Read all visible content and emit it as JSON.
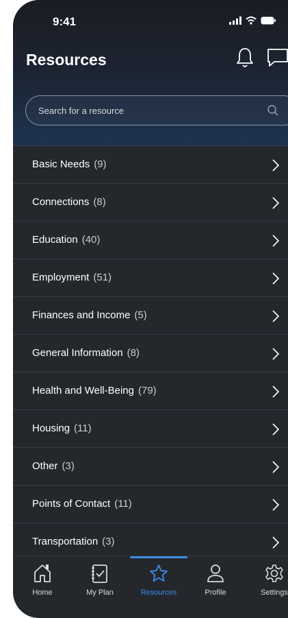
{
  "status": {
    "time": "9:41"
  },
  "header": {
    "title": "Resources"
  },
  "search": {
    "placeholder": "Search for a resource"
  },
  "categories": [
    {
      "label": "Basic Needs",
      "count": "(9)"
    },
    {
      "label": "Connections",
      "count": "(8)"
    },
    {
      "label": "Education",
      "count": "(40)"
    },
    {
      "label": "Employment",
      "count": "(51)"
    },
    {
      "label": "Finances and Income",
      "count": "(5)"
    },
    {
      "label": "General Information",
      "count": "(8)"
    },
    {
      "label": "Health and Well-Being",
      "count": "(79)"
    },
    {
      "label": "Housing",
      "count": "(11)"
    },
    {
      "label": "Other",
      "count": "(3)"
    },
    {
      "label": "Points of Contact",
      "count": "(11)"
    },
    {
      "label": "Transportation",
      "count": "(3)"
    }
  ],
  "tabs": [
    {
      "label": "Home",
      "icon": "home-icon"
    },
    {
      "label": "My Plan",
      "icon": "checklist-icon"
    },
    {
      "label": "Resources",
      "icon": "star-icon",
      "active": true
    },
    {
      "label": "Profile",
      "icon": "profile-icon"
    },
    {
      "label": "Settings",
      "icon": "gear-icon"
    }
  ],
  "colors": {
    "accent": "#3d8be8",
    "background": "#24272c"
  }
}
